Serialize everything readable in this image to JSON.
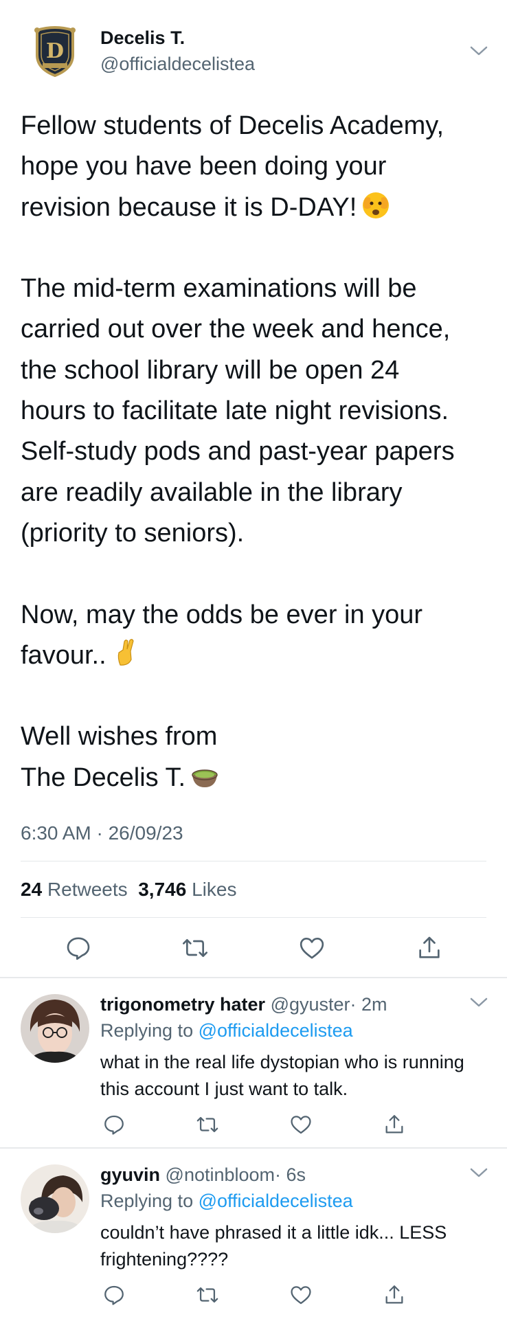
{
  "tweet": {
    "author_name": "Decelis T.",
    "author_handle": "@officialdecelistea",
    "lines": [
      "Fellow students of Decelis Academy,",
      "hope you have been doing your",
      "revision because it is D-DAY!",
      "",
      "The mid-term examinations will be",
      "carried out over the week and hence,",
      "the school library will be open 24",
      "hours to facilitate late night revisions.",
      "Self-study pods and past-year papers",
      "are readily available in the library",
      "(priority to seniors).",
      "",
      "Now, may the odds be ever in your",
      "favour..",
      "",
      "Well wishes from",
      "The Decelis T."
    ],
    "emojis": {
      "line3": "face-peeking-icon",
      "line14": "crossed-fingers-icon",
      "line17": "teacup-icon"
    },
    "timestamp": "6:30 AM · 26/09/23",
    "retweets_count": "24",
    "retweets_label": "Retweets",
    "likes_count": "3,746",
    "likes_label": "Likes"
  },
  "replies": [
    {
      "name": "trigonometry hater",
      "handle": "@gyuster",
      "time": "· 2m",
      "replying_label": "Replying to",
      "replying_to": "@officialdecelistea",
      "text": "what in the real life dystopian who is running this account I just want to talk."
    },
    {
      "name": "gyuvin",
      "handle": "@notinbloom",
      "time": "· 6s",
      "replying_label": "Replying to",
      "replying_to": "@officialdecelistea",
      "text": "couldn’t have phrased it a little idk... LESS frightening????"
    }
  ],
  "colors": {
    "text": "#0f1419",
    "secondary": "#536471",
    "link": "#1d9bf0",
    "divider": "#e7e9eb"
  }
}
